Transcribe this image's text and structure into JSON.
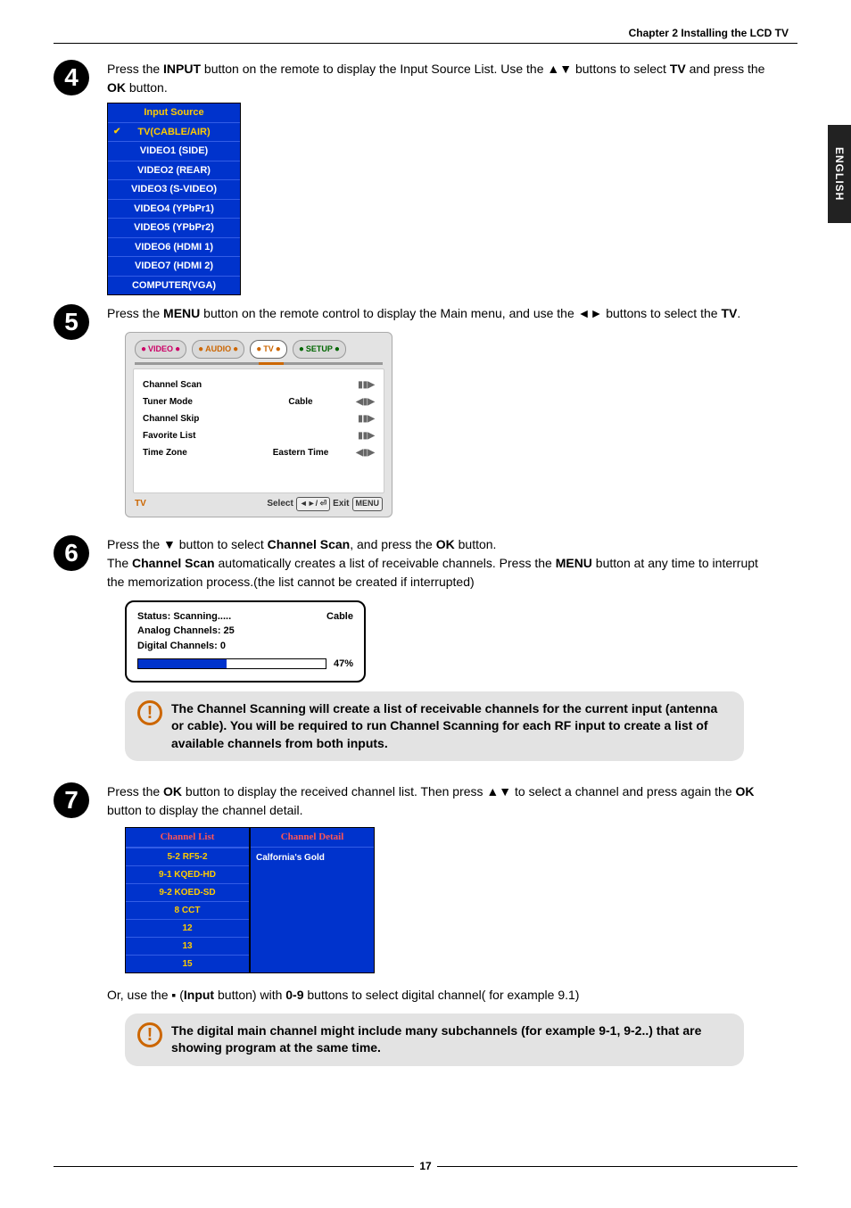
{
  "chapter_heading": "Chapter 2 Installing the LCD TV",
  "side_tab": "ENGLISH",
  "page_number": "17",
  "steps": {
    "s4": {
      "num": "4",
      "text_before": "Press the ",
      "bold1": "INPUT",
      "text_mid1": " button on the remote to display the Input Source List. Use the ▲▼ buttons to select ",
      "bold2": "TV",
      "text_mid2": " and press the ",
      "bold3": "OK",
      "text_end": " button."
    },
    "s5": {
      "num": "5",
      "text_before": "Press the ",
      "bold1": "MENU",
      "text_mid1": " button on the remote control to display the Main menu, and use the ◄► buttons to select the ",
      "bold2": "TV",
      "text_end": "."
    },
    "s6": {
      "num": "6",
      "line1_before": "Press the ▼ button to select ",
      "line1_bold1": "Channel Scan",
      "line1_mid": ", and press the ",
      "line1_bold2": "OK",
      "line1_end": " button.",
      "line2_before": "The ",
      "line2_bold1": "Channel Scan",
      "line2_mid": " automatically creates a list of receivable channels. Press the ",
      "line2_bold2": "MENU",
      "line2_end": " button at any time to interrupt the memorization process.(the list cannot be created if interrupted)"
    },
    "s7": {
      "num": "7",
      "line1_before": "Press the ",
      "line1_bold1": "OK",
      "line1_mid": " button to display the received channel list. Then press ▲▼ to select a channel and press again the ",
      "line1_bold2": "OK",
      "line1_end": " button to display the channel detail.",
      "line2_before": "Or, use the ▪ (",
      "line2_bold1": "Input",
      "line2_mid": " button) with ",
      "line2_bold2": "0-9",
      "line2_end": " buttons to select digital channel( for example 9.1)"
    }
  },
  "input_source": {
    "header": "Input Source",
    "items": [
      "TV(CABLE/AIR)",
      "VIDEO1 (SIDE)",
      "VIDEO2 (REAR)",
      "VIDEO3 (S-VIDEO)",
      "VIDEO4 (YPbPr1)",
      "VIDEO5 (YPbPr2)",
      "VIDEO6 (HDMI 1)",
      "VIDEO7 (HDMI 2)",
      "COMPUTER(VGA)"
    ]
  },
  "tv_menu": {
    "tabs": {
      "video": "VIDEO",
      "audio": "AUDIO",
      "tv": "TV",
      "setup": "SETUP"
    },
    "rows": [
      {
        "label": "Channel Scan",
        "val": "",
        "arrows": "▮▮▶"
      },
      {
        "label": "Tuner Mode",
        "val": "Cable",
        "arrows": "◀▮▶"
      },
      {
        "label": "Channel Skip",
        "val": "",
        "arrows": "▮▮▶"
      },
      {
        "label": "Favorite List",
        "val": "",
        "arrows": "▮▮▶"
      },
      {
        "label": "Time Zone",
        "val": "Eastern Time",
        "arrows": "◀▮▶"
      }
    ],
    "footer_label": "TV",
    "footer_select": "Select",
    "footer_key1": "◄►/ ⏎",
    "footer_exit": "Exit",
    "footer_key2": "MENU"
  },
  "scan": {
    "status": "Status: Scanning.....",
    "mode": "Cable",
    "analog": "Analog Channels: 25",
    "digital": "Digital Channels: 0",
    "percent": "47%",
    "percent_value": 47
  },
  "note1": "The Channel Scanning will create a list of receivable channels for the current input (antenna or cable). You will be required to run Channel Scanning for each RF input to create a list of available channels from both inputs.",
  "note2": "The digital main channel might include many subchannels (for example 9-1, 9-2..) that are showing program at the same time.",
  "channel_list": {
    "hdr_list": "Channel List",
    "hdr_detail": "Channel Detail",
    "rows": [
      "5-2 RF5-2",
      "9-1 KQED-HD",
      "9-2 KOED-SD",
      "8    CCT",
      "12",
      "13",
      "15"
    ],
    "detail": "Calfornia's Gold"
  }
}
